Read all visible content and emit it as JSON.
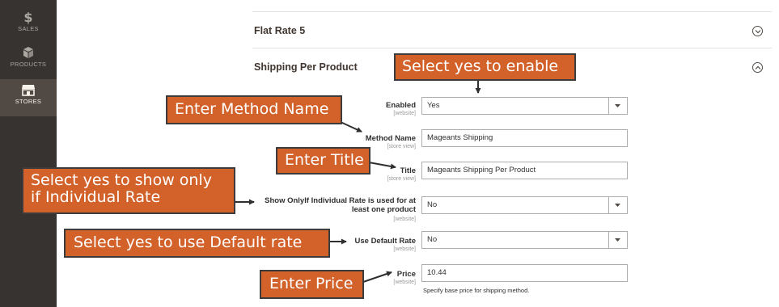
{
  "sidebar": {
    "items": [
      {
        "label": "SALES",
        "icon": "dollar-icon"
      },
      {
        "label": "PRODUCTS",
        "icon": "box-icon"
      },
      {
        "label": "STORES",
        "icon": "store-icon",
        "active": true
      }
    ]
  },
  "sections": {
    "flat_rate": {
      "title": "Flat Rate 5",
      "state": "collapsed"
    },
    "shipping_per_product": {
      "title": "Shipping Per Product",
      "state": "expanded"
    }
  },
  "form": {
    "enabled": {
      "label": "Enabled",
      "scope": "[website]",
      "value": "Yes"
    },
    "method_name": {
      "label": "Method Name",
      "scope": "[store view]",
      "value": "Mageants Shipping"
    },
    "title": {
      "label": "Title",
      "scope": "[store view]",
      "value": "Mageants Shipping Per Product"
    },
    "show_only": {
      "label_line1": "Show OnlyIf Individual Rate is used for at",
      "label_line2": "least one product",
      "scope": "[website]",
      "value": "No"
    },
    "use_default_rate": {
      "label": "Use Default Rate",
      "scope": "[website]",
      "value": "No"
    },
    "price": {
      "label": "Price",
      "scope": "[website]",
      "value": "10.44",
      "note": "Specify base price for shipping method."
    }
  },
  "annotations": {
    "enable": "Select yes to enable",
    "method_name": "Enter Method Name",
    "title": "Enter Title",
    "individual_line1": "Select yes to show only",
    "individual_line2": "if Individual Rate",
    "default_rate": "Select yes to use Default rate",
    "price": "Enter Price"
  },
  "colors": {
    "sidebar_bg": "#373330",
    "sidebar_active": "#514943",
    "callout_bg": "#d2612a",
    "arrow": "#2f2f2f"
  }
}
